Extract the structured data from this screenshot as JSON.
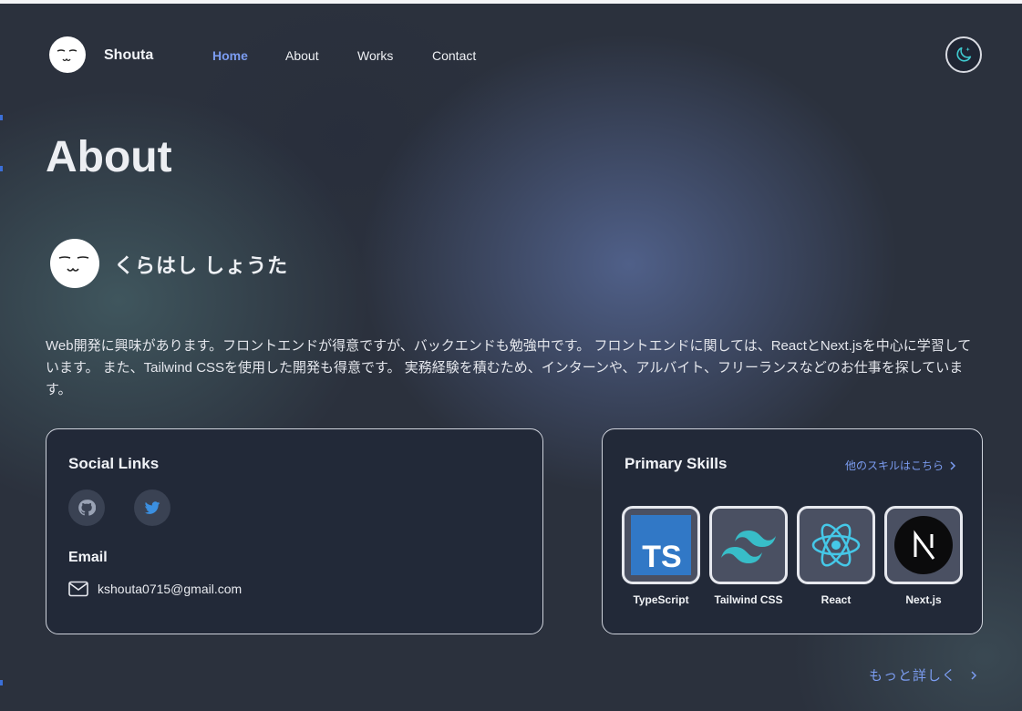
{
  "nav": {
    "brand": "Shouta",
    "links": [
      {
        "label": "Home",
        "active": true
      },
      {
        "label": "About",
        "active": false
      },
      {
        "label": "Works",
        "active": false
      },
      {
        "label": "Contact",
        "active": false
      }
    ],
    "theme_toggle_icon": "moon-stars-icon"
  },
  "page": {
    "title": "About"
  },
  "profile": {
    "name": "くらはし しょうた",
    "bio": "Web開発に興味があります。フロントエンドが得意ですが、バックエンドも勉強中です。 フロントエンドに関しては、ReactとNext.jsを中心に学習しています。 また、Tailwind CSSを使用した開発も得意です。 実務経験を積むため、インターンや、アルバイト、フリーランスなどのお仕事を探しています。"
  },
  "social": {
    "heading": "Social Links",
    "links": [
      {
        "icon": "github-icon"
      },
      {
        "icon": "twitter-icon"
      }
    ],
    "email_heading": "Email",
    "email": "kshouta0715@gmail.com"
  },
  "skills": {
    "heading": "Primary Skills",
    "other_link": "他のスキルはこちら",
    "items": [
      {
        "name": "TypeScript",
        "icon": "typescript-icon"
      },
      {
        "name": "Tailwind CSS",
        "icon": "tailwind-icon"
      },
      {
        "name": "React",
        "icon": "react-icon"
      },
      {
        "name": "Next.js",
        "icon": "nextjs-icon"
      }
    ]
  },
  "footer": {
    "more_link": "もっと詳しく"
  },
  "colors": {
    "accent": "#7b9cf0",
    "card_bg": "#222938",
    "page_bg": "#2b313d"
  }
}
